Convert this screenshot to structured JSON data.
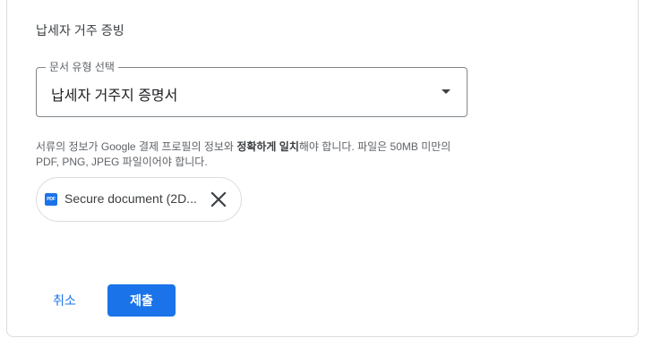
{
  "section": {
    "title": "납세자 거주 증빙"
  },
  "document_type": {
    "label": "문서 유형 선택",
    "value": "납세자 거주지 증명서"
  },
  "help": {
    "part1": "서류의 정보가 Google 결제 프로필의 정보와 ",
    "emphasis": "정확하게 일치",
    "part2": "해야 합니다. 파일은 50MB 미만의 PDF, PNG, JPEG 파일이어야 합니다."
  },
  "file": {
    "icon_text": "PDF",
    "name": "Secure document (2D..."
  },
  "actions": {
    "cancel_label": "취소",
    "submit_label": "제출"
  },
  "colors": {
    "accent": "#1a73e8",
    "border": "#dadce0",
    "text_secondary": "#5f6368"
  }
}
